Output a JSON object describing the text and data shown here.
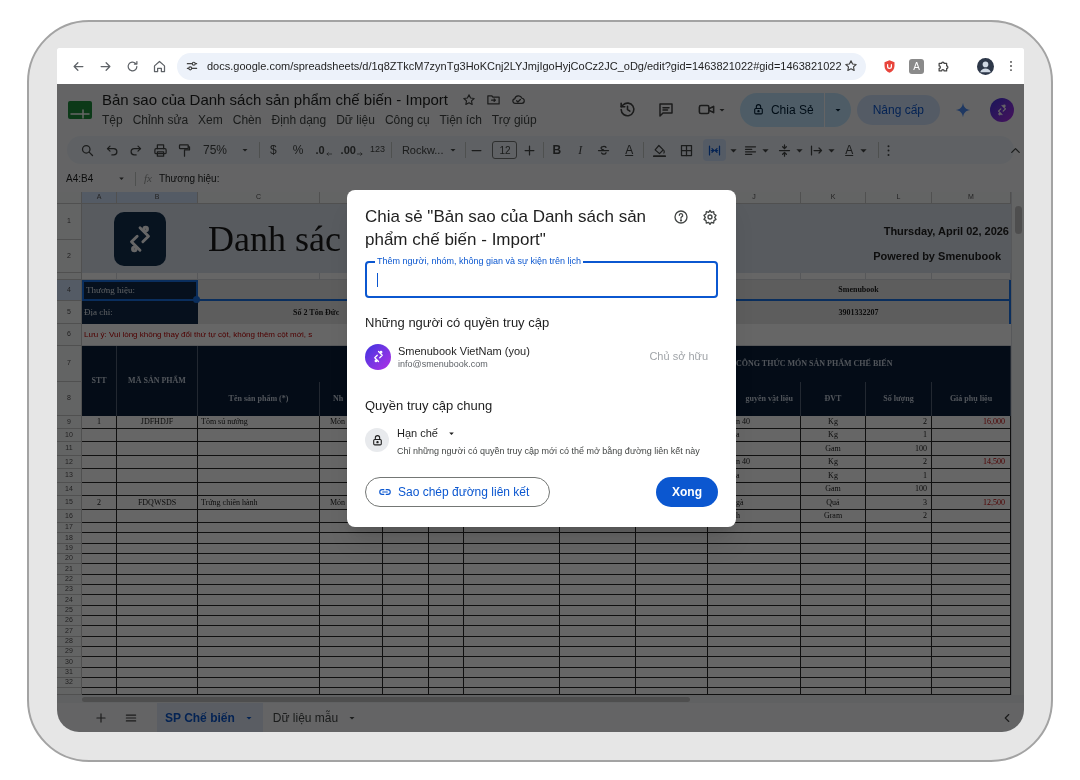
{
  "browser": {
    "url": "docs.google.com/spreadsheets/d/1q8ZTkcM7zynTg3HoKCnj2LYJmjIgoHyjCoCz2JC_oDg/edit?gid=1463821022#gid=1463821022",
    "extensions": [
      {
        "kind": "shield"
      },
      {
        "kind": "letter",
        "label": "A"
      },
      {
        "kind": "puzzle"
      }
    ]
  },
  "app": {
    "title": "Bản sao của Danh sách sản phẩm chế biến - Import",
    "menus": [
      "Tệp",
      "Chỉnh sửa",
      "Xem",
      "Chèn",
      "Định dạng",
      "Dữ liệu",
      "Công cụ",
      "Tiện ích",
      "Trợ giúp"
    ],
    "share_button": "Chia Sẻ",
    "upgrade_button": "Nâng cấp"
  },
  "toolbar": {
    "zoom": "75%",
    "currency": "$",
    "percent": "%",
    "decimal_decrease": ".0",
    "decimal_increase": ".00",
    "number_format": "123",
    "font": "Rockw...",
    "font_size": "12",
    "bold": "B",
    "italic": "I",
    "text_color": "A",
    "text_rotation": "A",
    "merge_selected": true
  },
  "formula_bar": {
    "cell_range": "A4:B4",
    "fx_label": "fx",
    "content": "Thương hiệu:"
  },
  "sheet": {
    "column_headers": [
      {
        "label": "A",
        "selected": true
      },
      {
        "label": "B",
        "selected": true
      },
      {
        "label": "C",
        "selected": false
      },
      {
        "label": "J",
        "selected": false
      },
      {
        "label": "K",
        "selected": false
      },
      {
        "label": "L",
        "selected": false
      },
      {
        "label": "M",
        "selected": false
      }
    ],
    "row_numbers": [
      {
        "label": "1",
        "selected": false
      },
      {
        "label": "2",
        "selected": false
      },
      {
        "label": "4",
        "selected": true
      },
      {
        "label": "5",
        "selected": false
      },
      {
        "label": "6",
        "selected": false
      },
      {
        "label": "7",
        "selected": false
      },
      {
        "label": "8",
        "selected": false
      },
      {
        "label": "9",
        "selected": false
      },
      {
        "label": "10",
        "selected": false
      },
      {
        "label": "11",
        "selected": false
      },
      {
        "label": "12",
        "selected": false
      },
      {
        "label": "13",
        "selected": false
      },
      {
        "label": "14",
        "selected": false
      },
      {
        "label": "15",
        "selected": false
      },
      {
        "label": "16",
        "selected": false
      },
      {
        "label": "17",
        "selected": false
      },
      {
        "label": "18",
        "selected": false
      },
      {
        "label": "19",
        "selected": false
      },
      {
        "label": "20",
        "selected": false
      },
      {
        "label": "21",
        "selected": false
      },
      {
        "label": "22",
        "selected": false
      },
      {
        "label": "23",
        "selected": false
      },
      {
        "label": "24",
        "selected": false
      },
      {
        "label": "25",
        "selected": false
      },
      {
        "label": "26",
        "selected": false
      },
      {
        "label": "27",
        "selected": false
      },
      {
        "label": "28",
        "selected": false
      },
      {
        "label": "29",
        "selected": false
      },
      {
        "label": "30",
        "selected": false
      },
      {
        "label": "31",
        "selected": false
      },
      {
        "label": "32",
        "selected": false
      }
    ],
    "header": {
      "title": "Danh sác",
      "date": "Thursday, April 02, 2026",
      "powered_by": "Powered by Smenubook"
    },
    "brand_row": {
      "label": "Thương hiệu:",
      "value": "Smenubook",
      "selected": true
    },
    "address_row": {
      "label": "Địa chỉ:",
      "address": "Số 2 Tôn Đức",
      "tax_code": "3901332207"
    },
    "note": "Lưu ý: Vui lòng không thay đổi thứ tự cột, không thêm cột mới, s",
    "table_headers": {
      "stt": "STT",
      "product_code": "MÃ SẢN PHẨM",
      "product_name": "Tên sản phẩm (*)",
      "column_d": "Nh",
      "recipe_title": "CÔNG THỨC MÓN SẢN PHẨM CHẾ BIẾN",
      "column_j": "guyên vật liệu",
      "unit": "ĐVT",
      "quantity": "Số lượng",
      "extra_cost": "Giá phụ liệu"
    },
    "rows": [
      {
        "stt": "1",
        "product_code": "JDFHDJF",
        "product_name": "Tôm sú nướng",
        "column_d": "Món",
        "column_j": "n 40",
        "unit": "Kg",
        "quantity": "2",
        "extra_cost": "16,000"
      },
      {
        "column_j": "a",
        "unit": "Kg",
        "quantity": "1"
      },
      {
        "unit": "Gam",
        "quantity": "100"
      },
      {
        "column_j": "n 40",
        "unit": "Kg",
        "quantity": "2",
        "extra_cost": "14,500"
      },
      {
        "column_j": "a",
        "unit": "Kg",
        "quantity": "1"
      },
      {
        "unit": "Gam",
        "quantity": "100"
      },
      {
        "stt": "2",
        "product_code": "FDQWSDS",
        "product_name": "Trứng chiên hành",
        "column_d": "Món",
        "column_j": "gà",
        "unit": "Quả",
        "quantity": "3",
        "extra_cost": "12,500"
      },
      {
        "column_j": "h",
        "unit": "Gram",
        "quantity": "2"
      }
    ]
  },
  "sheet_tabs": [
    {
      "label": "SP Chế biến",
      "selected": true
    },
    {
      "label": "Dữ liệu mẫu",
      "selected": false
    }
  ],
  "share_dialog": {
    "title": "Chia sẻ \"Bản sao của Danh sách sản phẩm chế biến - Import\"",
    "input_label": "Thêm người, nhóm, không gian và sự kiện trên lịch",
    "people_heading": "Những người có quyền truy cập",
    "people": [
      {
        "name": "Smenubook VietNam (you)",
        "email": "info@smenubook.com",
        "role": "Chủ sở hữu"
      }
    ],
    "general_heading": "Quyền truy cập chung",
    "access": {
      "level": "Hạn chế",
      "description": "Chỉ những người có quyền truy cập mới có thể mở bằng đường liên kết này"
    },
    "copy_link_button": "Sao chép đường liên kết",
    "done_button": "Xong"
  }
}
